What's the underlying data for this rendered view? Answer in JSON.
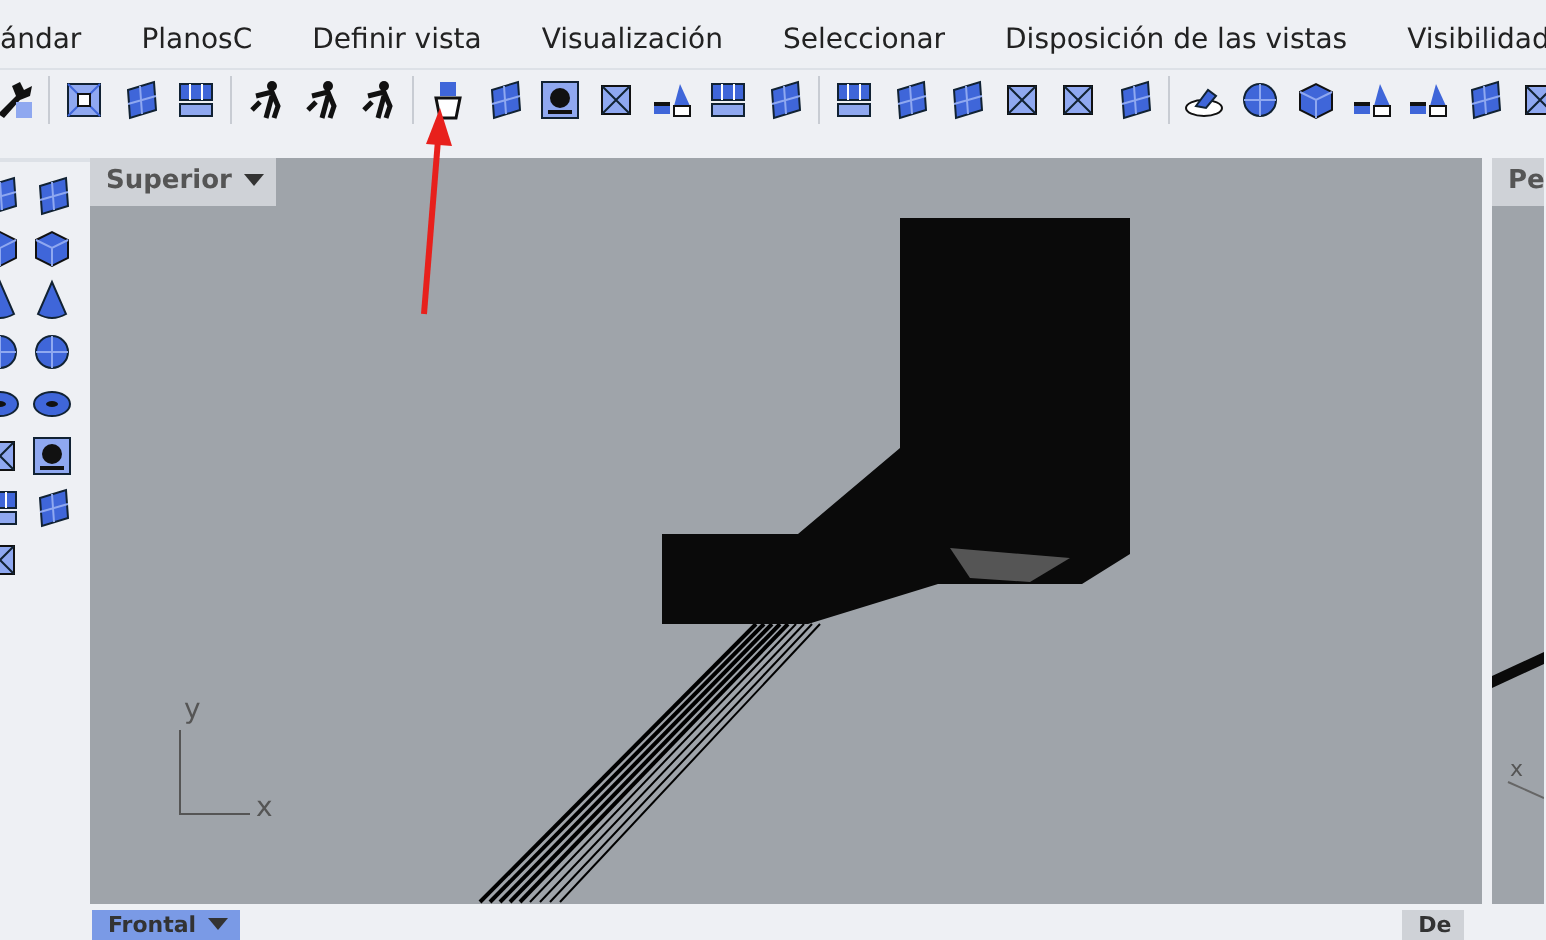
{
  "menu_tabs": [
    {
      "label": "ándar",
      "selected": false
    },
    {
      "label": "PlanosC",
      "selected": false
    },
    {
      "label": "Definir vista",
      "selected": false
    },
    {
      "label": "Visualización",
      "selected": false
    },
    {
      "label": "Seleccionar",
      "selected": false
    },
    {
      "label": "Disposición de las vistas",
      "selected": false
    },
    {
      "label": "Visibilidad",
      "selected": false
    }
  ],
  "viewports": [
    {
      "title": "Superior",
      "active": false,
      "axis_labels": [
        "y",
        "x"
      ]
    },
    {
      "title": "Pe",
      "active": false,
      "axis_labels": [
        "x"
      ]
    },
    {
      "title": "Frontal",
      "active": true
    },
    {
      "title": "De",
      "active": false
    }
  ]
}
